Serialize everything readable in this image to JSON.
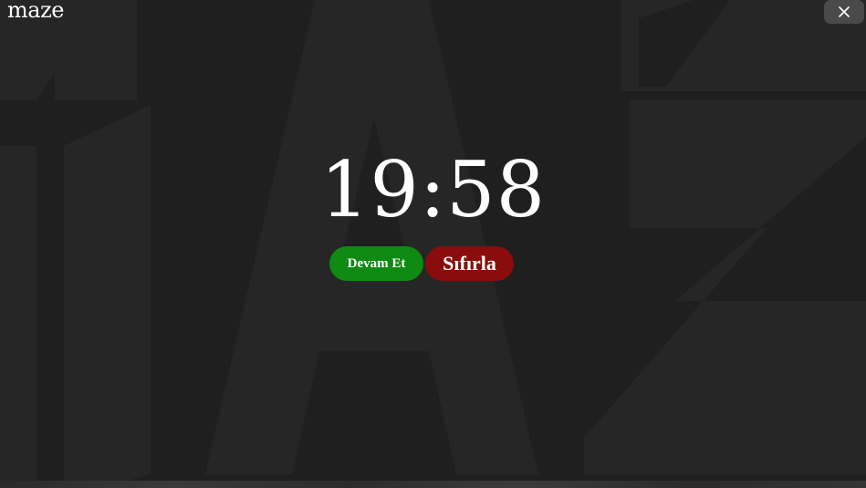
{
  "app": {
    "logo_text": "maze"
  },
  "window": {
    "close_icon": "close-icon"
  },
  "timer": {
    "display": "19:58"
  },
  "controls": {
    "continue_label": "Devam Et",
    "reset_label": "Sıfırla"
  },
  "colors": {
    "background": "#1f1f1f",
    "watermark": "#262626",
    "continue_button": "#0f8a12",
    "reset_button": "#8b0c0c",
    "close_button": "#4a4a4a",
    "text": "#ffffff"
  }
}
